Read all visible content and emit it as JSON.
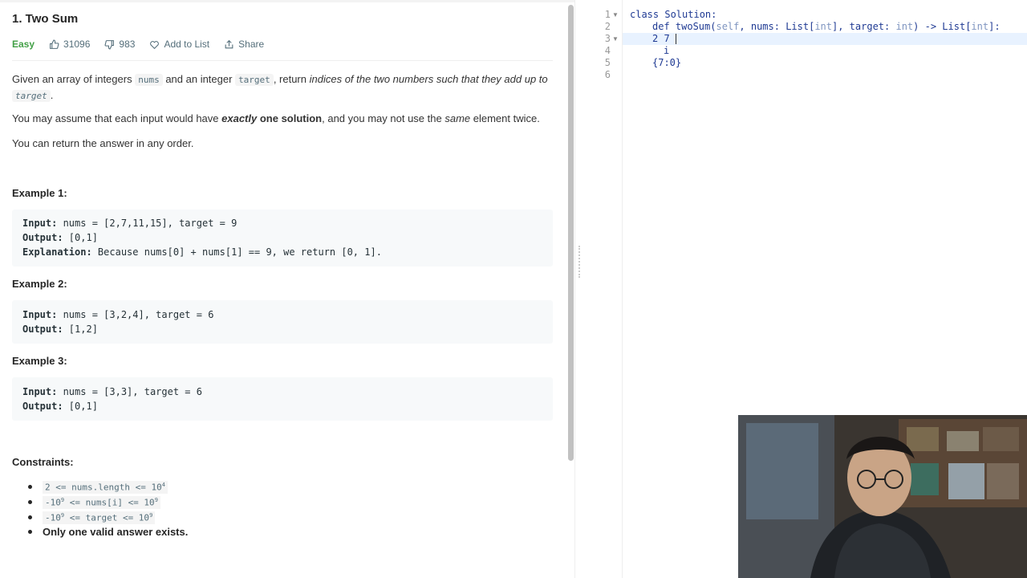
{
  "problem": {
    "title": "1. Two Sum",
    "difficulty": "Easy",
    "likes": "31096",
    "dislikes": "983",
    "add_to_list": "Add to List",
    "share": "Share",
    "desc1_a": "Given an array of integers ",
    "desc1_code1": "nums",
    "desc1_b": " and an integer ",
    "desc1_code2": "target",
    "desc1_c": ", return ",
    "desc1_em": "indices of the two numbers such that they add up to",
    "desc1_code3": "target",
    "desc1_d": ".",
    "desc2_a": "You may assume that each input would have ",
    "desc2_em": "exactly",
    "desc2_b": " one solution",
    "desc2_c": ", and you may not use the ",
    "desc2_em2": "same",
    "desc2_d": " element twice.",
    "desc3": "You can return the answer in any order."
  },
  "examples": [
    {
      "heading": "Example 1:",
      "input_label": "Input:",
      "input": " nums = [2,7,11,15], target = 9",
      "output_label": "Output:",
      "output": " [0,1]",
      "expl_label": "Explanation:",
      "expl": " Because nums[0] + nums[1] == 9, we return [0, 1]."
    },
    {
      "heading": "Example 2:",
      "input_label": "Input:",
      "input": " nums = [3,2,4], target = 6",
      "output_label": "Output:",
      "output": " [1,2]"
    },
    {
      "heading": "Example 3:",
      "input_label": "Input:",
      "input": " nums = [3,3], target = 6",
      "output_label": "Output:",
      "output": " [0,1]"
    }
  ],
  "constraints": {
    "heading": "Constraints:",
    "c1_a": "2 <= nums.length <= 10",
    "c1_sup": "4",
    "c2_a": "-10",
    "c2_sup1": "9",
    "c2_b": " <= nums[i] <= 10",
    "c2_sup2": "9",
    "c3_a": "-10",
    "c3_sup1": "9",
    "c3_b": " <= target <= 10",
    "c3_sup2": "9",
    "c4": "Only one valid answer exists."
  },
  "editor": {
    "line_numbers": [
      "1",
      "2",
      "3",
      "4",
      "5",
      "6"
    ],
    "l1_kw": "class",
    "l1_rest": " Solution:",
    "l2_kw": "def",
    "l2_fn": " twoSum(",
    "l2_self": "self",
    "l2_a": ", nums: List[",
    "l2_int1": "int",
    "l2_b": "], target: ",
    "l2_int2": "int",
    "l2_c": ") -> List[",
    "l2_int3": "int",
    "l2_d": "]:",
    "l3": "2 7 ",
    "l4": "i",
    "l5": "{7:0}"
  },
  "colors": {
    "accent_easy": "#43a047",
    "code_text": "#1f3a93",
    "line_highlight": "#e8f2ff"
  },
  "icons": [
    "thumbs-up-icon",
    "thumbs-down-icon",
    "heart-icon",
    "share-icon",
    "fold-arrow-icon"
  ]
}
